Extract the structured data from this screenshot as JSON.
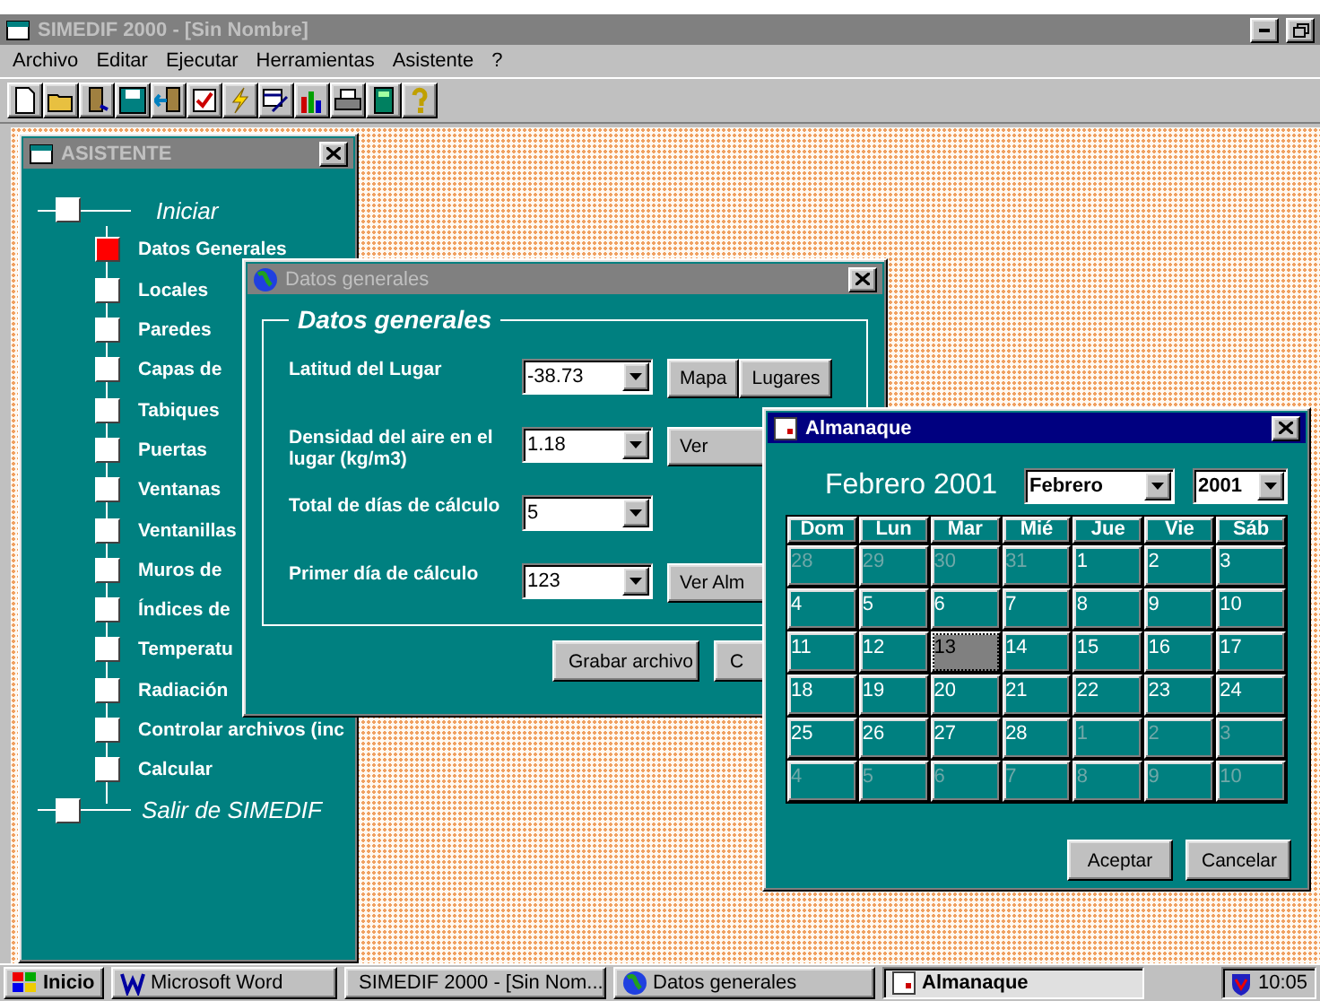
{
  "window": {
    "title": "SIMEDIF 2000 - [Sin Nombre]"
  },
  "menu": [
    "Archivo",
    "Editar",
    "Ejecutar",
    "Herramientas",
    "Asistente",
    "?"
  ],
  "toolbar": [
    {
      "kind": "new"
    },
    {
      "kind": "open"
    },
    {
      "kind": "exit"
    },
    {
      "kind": "save"
    },
    {
      "kind": "import"
    },
    {
      "kind": "check"
    },
    {
      "kind": "run"
    },
    {
      "kind": "edit"
    },
    {
      "kind": "chart"
    },
    {
      "kind": "print"
    },
    {
      "kind": "calc"
    },
    {
      "kind": "help"
    }
  ],
  "wizard": {
    "title": "ASISTENTE",
    "items": [
      {
        "label": "Iniciar",
        "children": [
          {
            "label": "Datos Generales",
            "selected": true
          },
          {
            "label": "Locales",
            "selected": false
          },
          {
            "label": "Paredes",
            "selected": false
          },
          {
            "label": "Capas de",
            "selected": false
          },
          {
            "label": "Tabiques",
            "selected": false
          },
          {
            "label": "Puertas",
            "selected": false
          },
          {
            "label": "Ventanas",
            "selected": false
          },
          {
            "label": "Ventanillas",
            "selected": false
          },
          {
            "label": "Muros de",
            "selected": false
          },
          {
            "label": "Índices de",
            "selected": false
          },
          {
            "label": "Temperatu",
            "selected": false
          },
          {
            "label": "Radiación",
            "selected": false
          },
          {
            "label": "Controlar archivos (inc",
            "selected": false
          },
          {
            "label": "Calcular",
            "selected": false
          }
        ]
      },
      {
        "label": "Salir de SIMEDIF"
      }
    ]
  },
  "general_dialog": {
    "title": "Datos generales",
    "group": "Datos generales",
    "fields": [
      {
        "label": "Latitud del Lugar",
        "value": "-38.73",
        "buttons": [
          "Mapa",
          "Lugares"
        ]
      },
      {
        "label": "Densidad del aire en el lugar (kg/m3)",
        "value": "1.18",
        "buttons": [
          "Ver"
        ]
      },
      {
        "label": "Total de días de cálculo",
        "value": "5"
      },
      {
        "label": "Primer día de cálculo",
        "value": "123",
        "buttons": [
          "Ver Alm"
        ]
      }
    ],
    "buttons": [
      "Grabar archivo",
      "C"
    ]
  },
  "calendar_dialog": {
    "title": "Almanaque",
    "heading": "Febrero 2001",
    "month": "Febrero",
    "year": "2001",
    "weekdays": [
      "Dom",
      "Lun",
      "Mar",
      "Mié",
      "Jue",
      "Vie",
      "Sáb"
    ],
    "weeks": [
      [
        {
          "day": "28",
          "muted": true,
          "selected": false
        },
        {
          "day": "29",
          "muted": true,
          "selected": false
        },
        {
          "day": "30",
          "muted": true,
          "selected": false
        },
        {
          "day": "31",
          "muted": true,
          "selected": false
        },
        {
          "day": "1",
          "muted": false,
          "selected": false
        },
        {
          "day": "2",
          "muted": false,
          "selected": false
        },
        {
          "day": "3",
          "muted": false,
          "selected": false
        }
      ],
      [
        {
          "day": "4",
          "muted": false,
          "selected": false
        },
        {
          "day": "5",
          "muted": false,
          "selected": false
        },
        {
          "day": "6",
          "muted": false,
          "selected": false
        },
        {
          "day": "7",
          "muted": false,
          "selected": false
        },
        {
          "day": "8",
          "muted": false,
          "selected": false
        },
        {
          "day": "9",
          "muted": false,
          "selected": false
        },
        {
          "day": "10",
          "muted": false,
          "selected": false
        }
      ],
      [
        {
          "day": "11",
          "muted": false,
          "selected": false
        },
        {
          "day": "12",
          "muted": false,
          "selected": false
        },
        {
          "day": "13",
          "muted": false,
          "selected": true
        },
        {
          "day": "14",
          "muted": false,
          "selected": false
        },
        {
          "day": "15",
          "muted": false,
          "selected": false
        },
        {
          "day": "16",
          "muted": false,
          "selected": false
        },
        {
          "day": "17",
          "muted": false,
          "selected": false
        }
      ],
      [
        {
          "day": "18",
          "muted": false,
          "selected": false
        },
        {
          "day": "19",
          "muted": false,
          "selected": false
        },
        {
          "day": "20",
          "muted": false,
          "selected": false
        },
        {
          "day": "21",
          "muted": false,
          "selected": false
        },
        {
          "day": "22",
          "muted": false,
          "selected": false
        },
        {
          "day": "23",
          "muted": false,
          "selected": false
        },
        {
          "day": "24",
          "muted": false,
          "selected": false
        }
      ],
      [
        {
          "day": "25",
          "muted": false,
          "selected": false
        },
        {
          "day": "26",
          "muted": false,
          "selected": false
        },
        {
          "day": "27",
          "muted": false,
          "selected": false
        },
        {
          "day": "28",
          "muted": false,
          "selected": false
        },
        {
          "day": "1",
          "muted": true,
          "selected": false
        },
        {
          "day": "2",
          "muted": true,
          "selected": false
        },
        {
          "day": "3",
          "muted": true,
          "selected": false
        }
      ],
      [
        {
          "day": "4",
          "muted": true,
          "selected": false
        },
        {
          "day": "5",
          "muted": true,
          "selected": false
        },
        {
          "day": "6",
          "muted": true,
          "selected": false
        },
        {
          "day": "7",
          "muted": true,
          "selected": false
        },
        {
          "day": "8",
          "muted": true,
          "selected": false
        },
        {
          "day": "9",
          "muted": true,
          "selected": false
        },
        {
          "day": "10",
          "muted": true,
          "selected": false
        }
      ]
    ],
    "buttons": [
      "Aceptar",
      "Cancelar"
    ]
  },
  "taskbar": {
    "start": "Inicio",
    "items": [
      {
        "label": "Microsoft Word",
        "kind": "word",
        "selected": false
      },
      {
        "label": "SIMEDIF 2000 - [Sin Nom...",
        "kind": "app",
        "selected": false
      },
      {
        "label": "Datos generales",
        "kind": "globe",
        "selected": false
      },
      {
        "label": "Almanaque",
        "kind": "calendar",
        "selected": true
      }
    ],
    "clock": "10:05"
  }
}
